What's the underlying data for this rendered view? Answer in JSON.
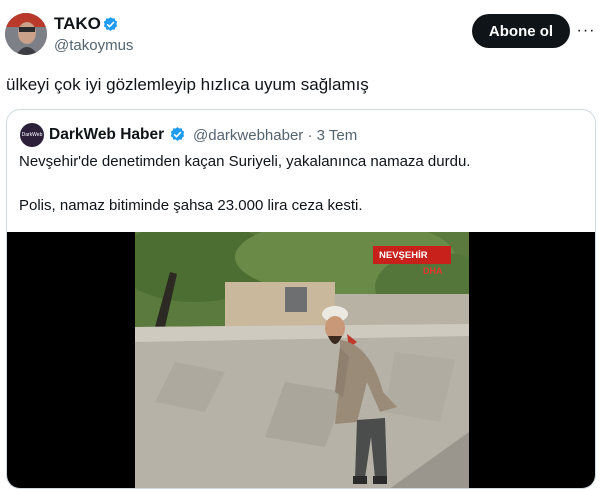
{
  "tweet": {
    "author_name": "TAKO",
    "author_handle": "@takoymus",
    "follow_label": "Abone ol",
    "more_label": "···",
    "text": "ülkeyi çok iyi gözlemleyip hızlıca uyum sağlamış"
  },
  "quoted": {
    "author_name": "DarkWeb Haber",
    "author_handle": "@darkwebhaber · 3 Tem",
    "avatar_text": "DarkWeb",
    "line1": "Nevşehir'de denetimden kaçan Suriyeli, yakalanınca namaza durdu.",
    "line2": "Polis, namaz bitiminde şahsa 23.000 lira ceza kesti.",
    "video": {
      "location_tag": "NEVŞEHİR",
      "agency_tag": "DHA"
    }
  },
  "colors": {
    "verified": "#1d9bf0",
    "text_primary": "#0f1419",
    "text_secondary": "#536471",
    "border": "#cfd9de",
    "tag_red": "#c8201a"
  },
  "icons": {
    "verified": "verified-badge-icon",
    "more": "more-horizontal-icon"
  }
}
